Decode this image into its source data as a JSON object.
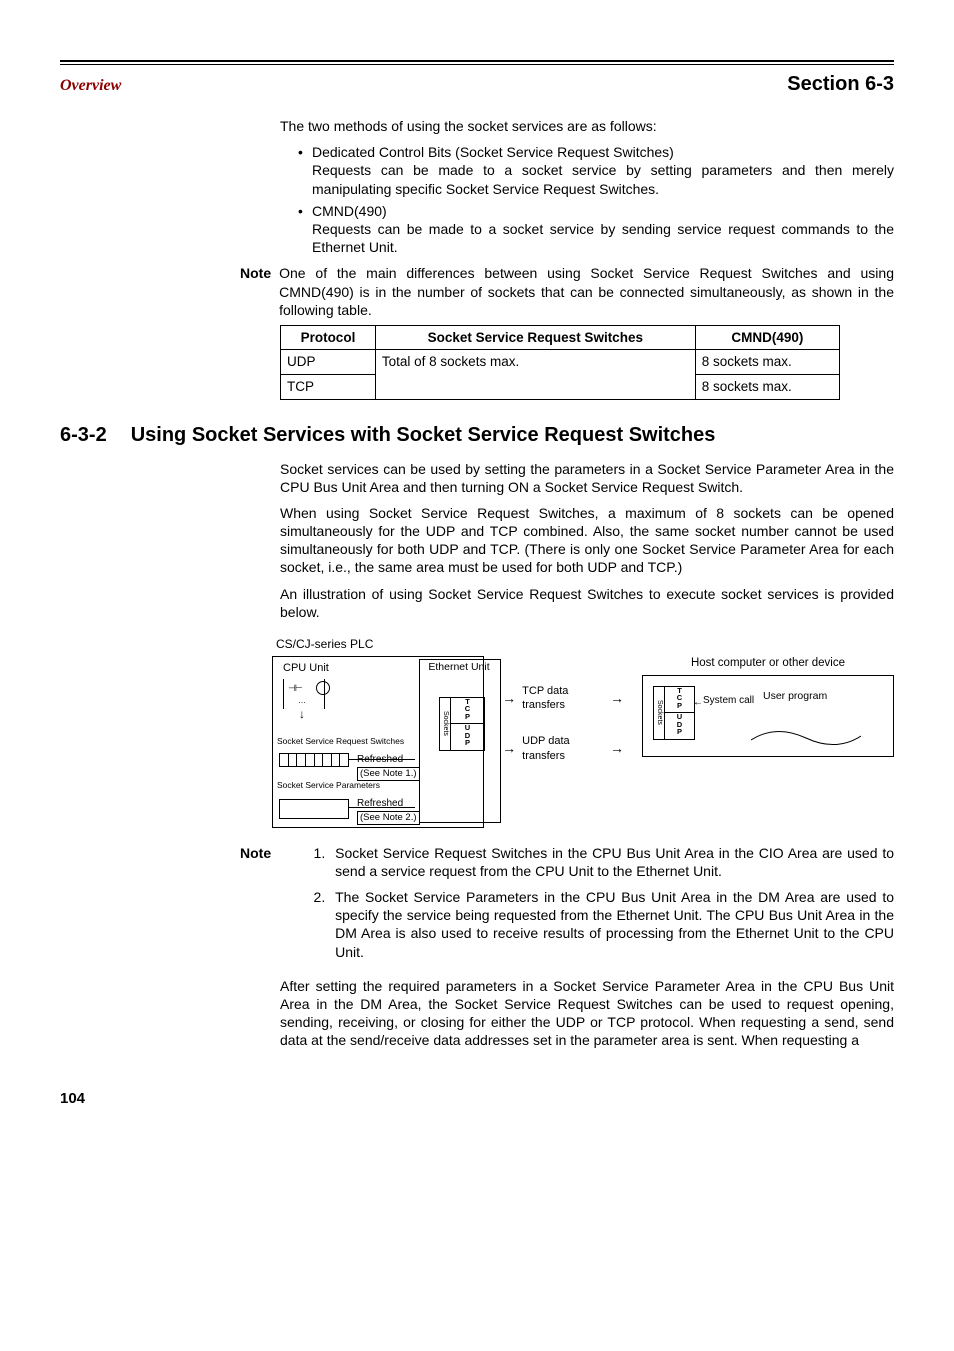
{
  "header": {
    "left": "Overview",
    "right": "Section 6-3"
  },
  "intro": "The two methods of using the socket services are as follows:",
  "bullets": {
    "b1": "Dedicated Control Bits (Socket Service Request Switches)",
    "b1sub": "Requests can be made to a socket service by setting parameters and then merely manipulating specific Socket Service Request Switches.",
    "b2": "CMND(490)",
    "b2sub": "Requests can be made to a socket service by sending service request commands to the Ethernet Unit."
  },
  "note1": {
    "label": "Note",
    "text": "One of the main differences between using Socket Service Request Switches and using CMND(490) is in the number of sockets that can be connected simultaneously, as shown in the following table."
  },
  "table": {
    "h1": "Protocol",
    "h2": "Socket Service Request Switches",
    "h3": "CMND(490)",
    "r1c1": "UDP",
    "r1c2": "Total of 8 sockets max.",
    "r1c3": "8 sockets max.",
    "r2c1": "TCP",
    "r2c3": "8 sockets max."
  },
  "section": {
    "num": "6-3-2",
    "title": "Using Socket Services with Socket Service Request Switches"
  },
  "para1": "Socket services can be used by setting the parameters in a Socket Service Parameter Area in the CPU Bus Unit Area and then turning ON a Socket Service Request Switch.",
  "para2": "When using Socket Service Request Switches, a maximum of 8 sockets can be opened simultaneously for the UDP and TCP combined. Also, the same socket number cannot be used simultaneously for both UDP and TCP. (There is only one Socket Service Parameter Area for each socket, i.e., the same area must be used for both UDP and TCP.)",
  "para3": "An illustration of using Socket Service Request Switches to execute socket services is provided below.",
  "diagram": {
    "plc_label": "CS/CJ-series PLC",
    "cpu": "CPU Unit",
    "eth": "Ethernet Unit",
    "ssrs": "Socket Service\nRequest Switches",
    "ssp": "Socket Service\nParameters",
    "refreshed": "Refreshed",
    "seen1": "(See Note 1.)",
    "seen2": "(See Note 2.)",
    "sockets": "Sockets",
    "tcp": "TCP",
    "udp": "UDP",
    "tcp_tx": "TCP data transfers",
    "udp_tx": "UDP data transfers",
    "host": "Host computer or other device",
    "syscall": "System call",
    "userprog": "User program"
  },
  "note2": {
    "label": "Note",
    "items": [
      "Socket Service Request Switches in the CPU Bus Unit Area in the CIO Area are used to send a service request from the CPU Unit to the Ethernet Unit.",
      "The Socket Service Parameters in the CPU Bus Unit Area in the DM Area are used to specify the service being requested from the Ethernet Unit. The CPU Bus Unit Area in the DM Area is also used to receive results of processing from the Ethernet Unit to the CPU Unit."
    ]
  },
  "after": "After setting the required parameters in a Socket Service Parameter Area in the CPU Bus Unit Area in the DM Area, the Socket Service Request Switches can be used to request opening, sending, receiving, or closing for either the UDP or TCP protocol. When requesting a send, send data at the send/receive data addresses set in the parameter area is sent. When requesting a",
  "page": "104"
}
